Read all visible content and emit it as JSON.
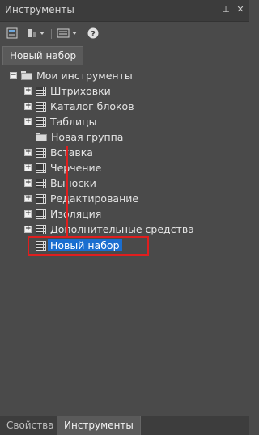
{
  "window": {
    "title": "Инструменты"
  },
  "titlebar_buttons": {
    "pin": "⊥",
    "close": "✕"
  },
  "toolbar": {
    "icons": [
      "palette-properties-icon",
      "view-options-icon",
      "list-view-icon",
      "help-icon"
    ],
    "help_glyph": "?"
  },
  "tab": {
    "label": "Новый набор"
  },
  "tree": {
    "root": {
      "label": "Мои инструменты"
    },
    "items": [
      {
        "label": "Штриховки",
        "expandable": true
      },
      {
        "label": "Каталог блоков",
        "expandable": true
      },
      {
        "label": "Таблицы",
        "expandable": true
      },
      {
        "label": "Новая группа",
        "expandable": false
      },
      {
        "label": "Вставка",
        "expandable": true
      },
      {
        "label": "Черчение",
        "expandable": true
      },
      {
        "label": "Выноски",
        "expandable": true
      },
      {
        "label": "Редактирование",
        "expandable": true
      },
      {
        "label": "Изоляция",
        "expandable": true
      },
      {
        "label": "Дополнительные средства",
        "expandable": true
      },
      {
        "label": "Новый набор",
        "expandable": false,
        "selected": true
      }
    ],
    "highlight_color": "#e01e1e",
    "selection_color": "#1a6ed0"
  },
  "bottom_tabs": [
    {
      "label": "Свойства",
      "active": false
    },
    {
      "label": "Инструменты",
      "active": true
    }
  ]
}
